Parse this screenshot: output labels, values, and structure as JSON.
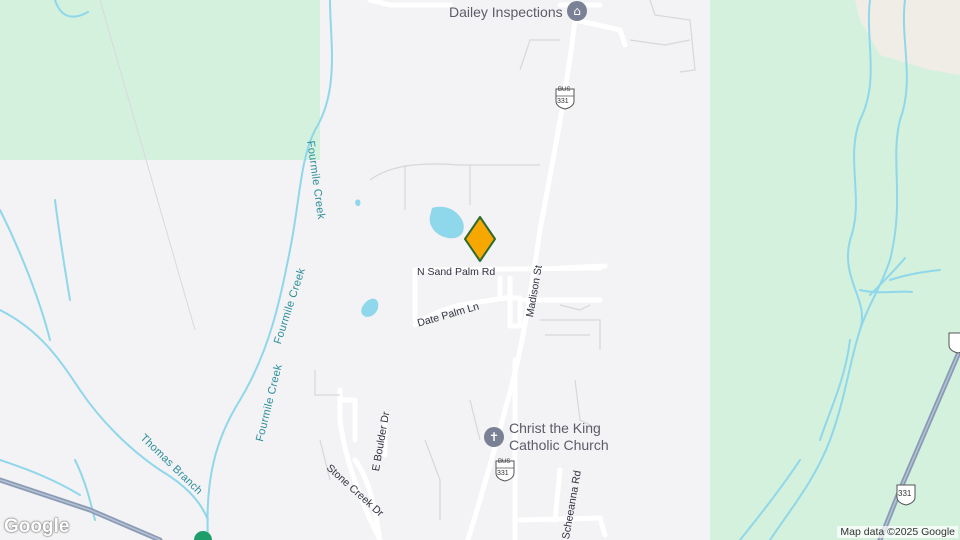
{
  "map": {
    "pois": {
      "dailey": "Dailey Inspections",
      "church_line1": "Christ the King",
      "church_line2": "Catholic Church"
    },
    "streets": {
      "n_sand_palm": "N Sand Palm Rd",
      "date_palm": "Date Palm Ln",
      "madison": "Madison St",
      "stone_creek": "Stone Creek Dr",
      "e_boulder": "E Boulder Dr",
      "cheeanna": "Scheeanna Rd"
    },
    "creeks": {
      "fourmile_a": "Fourmile Creek",
      "fourmile_b": "Fourmile Creek",
      "fourmile_c": "Fourmile Creek",
      "thomas": "Thomas Branch"
    },
    "shields": {
      "bus_label": "BUS",
      "route_number": "331"
    },
    "attribution": "Map data ©2025 Google",
    "logo": "Google",
    "colors": {
      "background": "#f3f2f4",
      "park": "#d4f1de",
      "water": "#8fd7ea",
      "road": "#ffffff",
      "highway": "#8a9bb6",
      "marker": "#f7a800",
      "marker_outline": "#2f6b2f"
    },
    "icons": {
      "dailey": "bank-icon",
      "church": "cross-icon",
      "marker": "location-pin-icon"
    }
  }
}
